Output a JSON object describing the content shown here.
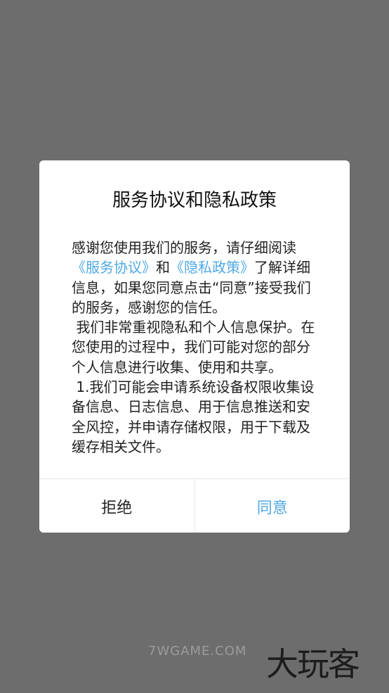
{
  "dialog": {
    "title": "服务协议和隐私政策",
    "body": {
      "intro_prefix": "感谢您使用我们的服务，请仔细阅读",
      "service_link": "《服务协议》",
      "and_text": "和",
      "privacy_link": "《隐私政策》",
      "intro_suffix": "了解详细信息，如果您同意点击“同意”接受我们的服务，感谢您的信任。",
      "paragraph_2": " 我们非常重视隐私和个人信息保护。在您使用的过程中，我们可能对您的部分个人信息进行收集、使用和共享。",
      "paragraph_3": " 1.我们可能会申请系统设备权限收集设备信息、日志信息、用于信息推送和安全风控，并申请存储权限，用于下载及缓存相关文件。"
    },
    "buttons": {
      "reject": "拒绝",
      "agree": "同意"
    }
  },
  "watermark": {
    "site": "7WGAME.COM",
    "brand": "大玩客"
  },
  "colors": {
    "overlay": "#6d6d6d",
    "link": "#4fa9e6",
    "dialog_bg": "#ffffff"
  }
}
